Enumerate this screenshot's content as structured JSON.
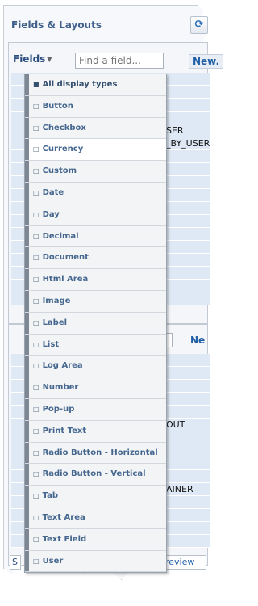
{
  "panel": {
    "title": "Fields & Layouts",
    "refresh_icon": "refresh-icon",
    "fields_menu_label": "Fields",
    "search_placeholder": "Find a field...",
    "new_button_label": "New.",
    "new_button_label_mid": "Ne"
  },
  "background_rows_top": [
    "",
    "",
    "",
    "",
    "SER",
    "_BY_USER",
    "",
    "",
    "",
    "",
    "",
    "",
    "",
    "",
    "",
    "",
    "",
    ""
  ],
  "background_rows_bottom": [
    "",
    "",
    "",
    "",
    "",
    "OUT",
    "",
    "",
    "",
    "",
    "AINER",
    "",
    "",
    "",
    ""
  ],
  "bottom_tabs": {
    "left_label": "S",
    "right_label": "review"
  },
  "dropdown": {
    "items": [
      {
        "label": "All display types",
        "selected": false
      },
      {
        "label": "Button",
        "selected": false
      },
      {
        "label": "Checkbox",
        "selected": false
      },
      {
        "label": "Currency",
        "selected": true
      },
      {
        "label": "Custom",
        "selected": false
      },
      {
        "label": "Date",
        "selected": false
      },
      {
        "label": "Day",
        "selected": false
      },
      {
        "label": "Decimal",
        "selected": false
      },
      {
        "label": "Document",
        "selected": false
      },
      {
        "label": "Html Area",
        "selected": false
      },
      {
        "label": "Image",
        "selected": false
      },
      {
        "label": "Label",
        "selected": false
      },
      {
        "label": "List",
        "selected": false
      },
      {
        "label": "Log Area",
        "selected": false
      },
      {
        "label": "Number",
        "selected": false
      },
      {
        "label": "Pop-up",
        "selected": false
      },
      {
        "label": "Print Text",
        "selected": false
      },
      {
        "label": "Radio Button - Horizontal",
        "selected": false
      },
      {
        "label": "Radio Button - Vertical",
        "selected": false
      },
      {
        "label": "Tab",
        "selected": false
      },
      {
        "label": "Text Area",
        "selected": false
      },
      {
        "label": "Text Field",
        "selected": false
      },
      {
        "label": "User",
        "selected": false
      }
    ]
  }
}
